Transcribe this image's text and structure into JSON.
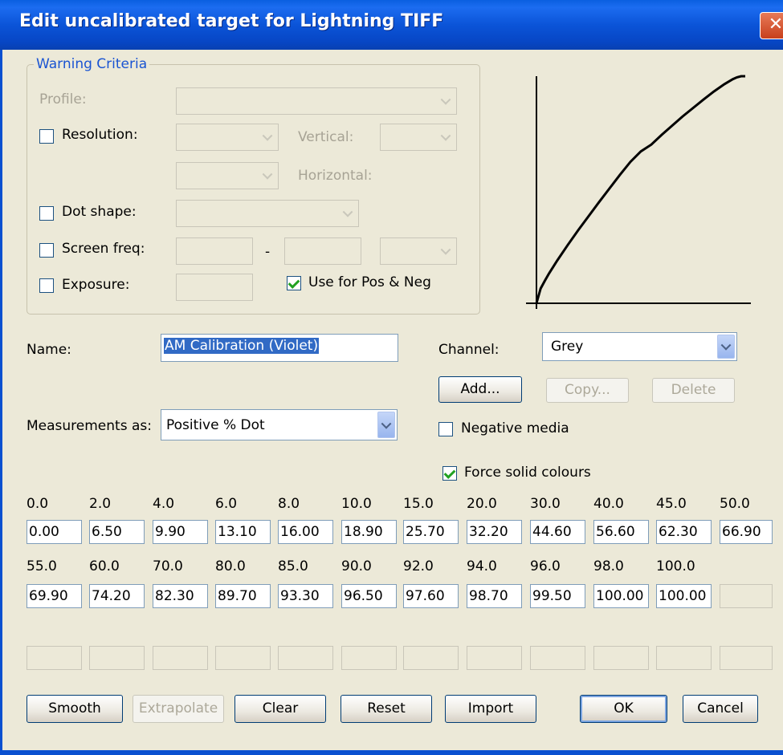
{
  "window": {
    "title": "Edit uncalibrated target for Lightning TIFF",
    "close_glyph": "✕"
  },
  "warning": {
    "legend": "Warning Criteria",
    "profile_label": "Profile:",
    "resolution_label": "Resolution:",
    "vertical_label": "Vertical:",
    "horizontal_label": "Horizontal:",
    "dot_shape_label": "Dot shape:",
    "screen_freq_label": "Screen freq:",
    "screen_freq_dash": "-",
    "exposure_label": "Exposure:",
    "use_pos_neg_label": "Use for Pos & Neg",
    "use_pos_neg_checked": true
  },
  "name_label": "Name:",
  "name_value": "AM Calibration (Violet)",
  "channel": {
    "label": "Channel:",
    "value": "Grey"
  },
  "buttons_top": {
    "add": "Add...",
    "copy": "Copy...",
    "delete": "Delete"
  },
  "measurements": {
    "label": "Measurements as:",
    "value": "Positive % Dot"
  },
  "negative_media": {
    "label": "Negative media",
    "checked": false
  },
  "force_solid": {
    "label": "Force solid colours",
    "checked": true
  },
  "table": {
    "row1": {
      "headers": [
        "0.0",
        "2.0",
        "4.0",
        "6.0",
        "8.0",
        "10.0",
        "15.0",
        "20.0",
        "30.0",
        "40.0",
        "45.0",
        "50.0"
      ],
      "values": [
        "0.00",
        "6.50",
        "9.90",
        "13.10",
        "16.00",
        "18.90",
        "25.70",
        "32.20",
        "44.60",
        "56.60",
        "62.30",
        "66.90"
      ]
    },
    "row2": {
      "headers": [
        "55.0",
        "60.0",
        "70.0",
        "80.0",
        "85.0",
        "90.0",
        "92.0",
        "94.0",
        "96.0",
        "98.0",
        "100.0",
        ""
      ],
      "values": [
        "69.90",
        "74.20",
        "82.30",
        "89.70",
        "93.30",
        "96.50",
        "97.60",
        "98.70",
        "99.50",
        "100.00",
        "100.00",
        ""
      ]
    },
    "row3": {
      "values": [
        "",
        "",
        "",
        "",
        "",
        "",
        "",
        "",
        "",
        "",
        "",
        ""
      ]
    }
  },
  "buttons_bottom": {
    "smooth": "Smooth",
    "extrapolate": "Extrapolate",
    "clear": "Clear",
    "reset": "Reset",
    "import": "Import",
    "ok": "OK",
    "cancel": "Cancel"
  },
  "curve": {
    "x": [
      0,
      2,
      4,
      6,
      8,
      10,
      15,
      20,
      30,
      40,
      45,
      50,
      55,
      60,
      70,
      80,
      85,
      90,
      92,
      94,
      96,
      98,
      100
    ],
    "y": [
      0.0,
      6.5,
      9.9,
      13.1,
      16.0,
      18.9,
      25.7,
      32.2,
      44.6,
      56.6,
      62.3,
      66.9,
      69.9,
      74.2,
      82.3,
      89.7,
      93.3,
      96.5,
      97.6,
      98.7,
      99.5,
      100.0,
      100.0
    ],
    "xlim": [
      0,
      100
    ],
    "ylim": [
      0,
      100
    ],
    "line_color": "#000000"
  }
}
